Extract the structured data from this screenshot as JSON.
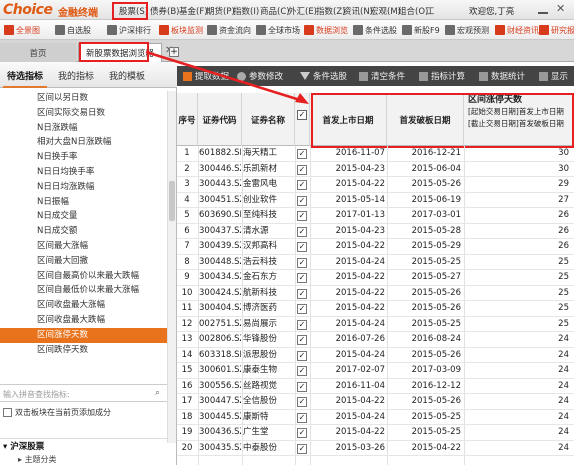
{
  "brand": {
    "logo": "Choice",
    "logo_cn": "金融终端"
  },
  "menu": [
    "股票(S)",
    "债券(B)",
    "基金(F)",
    "期货(P)",
    "指数(I)",
    "商品(C)",
    "外汇(E)",
    "指数(Z)",
    "资讯(N)",
    "宏观(M)",
    "组合(O)",
    "工"
  ],
  "user": "欢迎您,丁亮",
  "window_icons": [
    "minimize-icon",
    "close-icon"
  ],
  "toolbar": [
    "全景图",
    "自选股",
    "沪深排行",
    "板块监测",
    "资金流向",
    "全球市场",
    "数据浏览",
    "条件选股",
    "新股F9",
    "宏观预测",
    "财经资讯",
    "研究报告"
  ],
  "tabs": {
    "home": "首页",
    "active": "新股票数据浏览器"
  },
  "left": {
    "tabs": [
      "待选指标",
      "我的指标",
      "我的模板"
    ],
    "indicators": [
      "区间以另日数",
      "区间实际交易日数",
      "N日涨跌幅",
      "相对大盘N日涨跌幅",
      "N日换手率",
      "N日日均换手率",
      "N日日均涨跌幅",
      "N日振幅",
      "N日成交量",
      "N日成交额",
      "区间最大涨幅",
      "区间最大回撤",
      "区间自最高价以来最大跌幅",
      "区间自最低价以来最大涨幅",
      "区间收盘最大涨幅",
      "区间收盘最大跌幅",
      "区间涨停天数",
      "区间跌停天数"
    ],
    "selected_index": 16,
    "search_placeholder": "输入拼音查找指标:",
    "checkbox_label": "双击板块在当前页添加成分",
    "section": "沪深股票",
    "sub": "主题分类"
  },
  "right_toolbar": [
    "提取数据",
    "参数修改",
    "条件选股",
    "清空条件",
    "指标计算",
    "数据统计",
    "显示"
  ],
  "table": {
    "headers": {
      "seq": "序号",
      "code": "证券代码",
      "name": "证券名称",
      "d1": "首发上市日期",
      "d2": "首发破板日期"
    },
    "last_header": {
      "title": "区间涨停天数",
      "line2": "[起始交易日期]首发上市日期",
      "line3": "[截止交易日期]首发破板日期"
    },
    "rows": [
      {
        "seq": "1",
        "code": "601882.SH",
        "name": "海天精工",
        "d1": "2016-11-07",
        "d2": "2016-12-21",
        "days": "30"
      },
      {
        "seq": "2",
        "code": "300446.SZ",
        "name": "乐凯新材",
        "d1": "2015-04-23",
        "d2": "2015-06-04",
        "days": "30"
      },
      {
        "seq": "3",
        "code": "300443.SZ",
        "name": "金雷风电",
        "d1": "2015-04-22",
        "d2": "2015-05-26",
        "days": "29"
      },
      {
        "seq": "4",
        "code": "300451.SZ",
        "name": "创业软件",
        "d1": "2015-05-14",
        "d2": "2015-06-19",
        "days": "27"
      },
      {
        "seq": "5",
        "code": "603690.SH",
        "name": "至纯科技",
        "d1": "2017-01-13",
        "d2": "2017-03-01",
        "days": "26"
      },
      {
        "seq": "6",
        "code": "300437.SZ",
        "name": "清水源",
        "d1": "2015-04-23",
        "d2": "2015-05-28",
        "days": "26"
      },
      {
        "seq": "7",
        "code": "300439.SZ",
        "name": "汉邦高科",
        "d1": "2015-04-22",
        "d2": "2015-05-29",
        "days": "26"
      },
      {
        "seq": "8",
        "code": "300448.SZ",
        "name": "浩云科技",
        "d1": "2015-04-24",
        "d2": "2015-05-25",
        "days": "25"
      },
      {
        "seq": "9",
        "code": "300434.SZ",
        "name": "金石东方",
        "d1": "2015-04-22",
        "d2": "2015-05-27",
        "days": "25"
      },
      {
        "seq": "10",
        "code": "300424.SZ",
        "name": "航新科技",
        "d1": "2015-04-22",
        "d2": "2015-05-26",
        "days": "25"
      },
      {
        "seq": "11",
        "code": "300404.SZ",
        "name": "博济医药",
        "d1": "2015-04-22",
        "d2": "2015-05-26",
        "days": "25"
      },
      {
        "seq": "12",
        "code": "002751.SZ",
        "name": "易尚展示",
        "d1": "2015-04-24",
        "d2": "2015-05-25",
        "days": "25"
      },
      {
        "seq": "13",
        "code": "002806.SZ",
        "name": "华锋股份",
        "d1": "2016-07-26",
        "d2": "2016-08-24",
        "days": "24"
      },
      {
        "seq": "14",
        "code": "603318.SH",
        "name": "派思股份",
        "d1": "2015-04-24",
        "d2": "2015-05-26",
        "days": "24"
      },
      {
        "seq": "15",
        "code": "300601.SZ",
        "name": "康泰生物",
        "d1": "2017-02-07",
        "d2": "2017-03-09",
        "days": "24"
      },
      {
        "seq": "16",
        "code": "300556.SZ",
        "name": "丝路视觉",
        "d1": "2016-11-04",
        "d2": "2016-12-12",
        "days": "24"
      },
      {
        "seq": "17",
        "code": "300447.SZ",
        "name": "全信股份",
        "d1": "2015-04-22",
        "d2": "2015-05-26",
        "days": "24"
      },
      {
        "seq": "18",
        "code": "300445.SZ",
        "name": "康斯特",
        "d1": "2015-04-24",
        "d2": "2015-05-25",
        "days": "24"
      },
      {
        "seq": "19",
        "code": "300436.SZ",
        "name": "广生堂",
        "d1": "2015-04-22",
        "d2": "2015-05-25",
        "days": "24"
      },
      {
        "seq": "20",
        "code": "300435.SZ",
        "name": "中泰股份",
        "d1": "2015-03-26",
        "d2": "2015-04-22",
        "days": "24"
      }
    ]
  },
  "colors": {
    "accent": "#e8731c",
    "annotation": "#e62020",
    "toolbar_dark": "#444444"
  }
}
